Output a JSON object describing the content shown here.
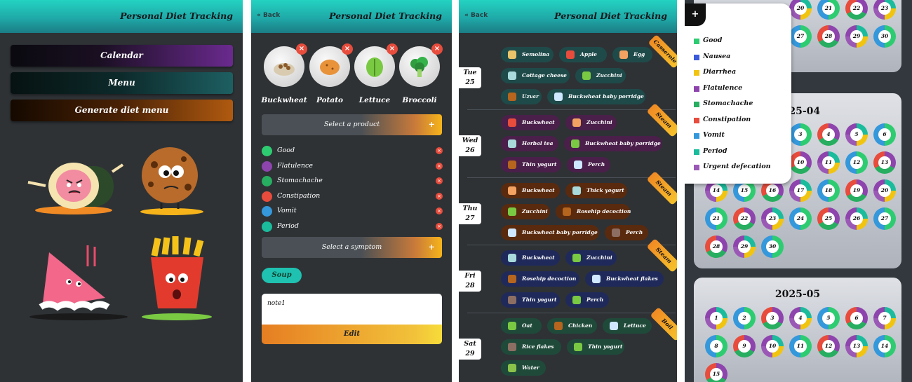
{
  "app_title": "Personal Diet Tracking",
  "back_label": "« Back",
  "home": {
    "buttons": [
      "Calendar",
      "Menu",
      "Generate diet menu"
    ]
  },
  "diary": {
    "products": [
      "Buckwheat",
      "Potato",
      "Lettuce",
      "Broccoli"
    ],
    "select_product": "Select a product",
    "symptoms": [
      {
        "label": "Good",
        "color": "#2ecc71"
      },
      {
        "label": "Flatulence",
        "color": "#8e44ad"
      },
      {
        "label": "Stomachache",
        "color": "#27ae60"
      },
      {
        "label": "Constipation",
        "color": "#e74c3c"
      },
      {
        "label": "Vomit",
        "color": "#3498db"
      },
      {
        "label": "Period",
        "color": "#1abc9c"
      }
    ],
    "select_symptom": "Select a symptom",
    "soup_tag": "Soup",
    "note_value": "note1",
    "edit_label": "Edit"
  },
  "menu": {
    "days": [
      {
        "dow": "Tue",
        "day": "25",
        "tag": "Casserole",
        "items": [
          "Semolina",
          "Apple",
          "Egg",
          "Cottage cheese",
          "Zucchini",
          "Uzvar",
          "Buckwheat baby porridge"
        ]
      },
      {
        "dow": "Wed",
        "day": "26",
        "tag": "Steam",
        "items": [
          "Buckwheat",
          "Zucchini",
          "Herbal tea",
          "Buckwheat baby porridge",
          "Thin yogurt",
          "Perch"
        ]
      },
      {
        "dow": "Thu",
        "day": "27",
        "tag": "Steam",
        "items": [
          "Buckwheat",
          "Thick yogurt",
          "Zucchini",
          "Rosehip decoction",
          "Buckwheat baby porridge",
          "Perch"
        ]
      },
      {
        "dow": "Fri",
        "day": "28",
        "tag": "Steam",
        "items": [
          "Buckwheat",
          "Zucchini",
          "Rosehip decoction",
          "Buckwheat flakes",
          "Thin yogurt",
          "Perch"
        ]
      },
      {
        "dow": "Sat",
        "day": "29",
        "tag": "Boil",
        "items": [
          "Oat",
          "Chicken",
          "Lettuce",
          "Rice flakes",
          "Thin yogurt",
          "Water"
        ]
      }
    ]
  },
  "calendar": {
    "months": [
      "2025-04",
      "2025-05"
    ],
    "top_days": [
      "20",
      "21",
      "22",
      "23",
      "27",
      "28",
      "29",
      "30"
    ],
    "april_days": 30,
    "may_days": 15,
    "legend_plus": "+",
    "legend": [
      {
        "label": "Good",
        "color": "#2ecc71"
      },
      {
        "label": "Nausea",
        "color": "#3b5bdb"
      },
      {
        "label": "Diarrhea",
        "color": "#f1c40f"
      },
      {
        "label": "Flatulence",
        "color": "#8e44ad"
      },
      {
        "label": "Stomachache",
        "color": "#27ae60"
      },
      {
        "label": "Constipation",
        "color": "#e74c3c"
      },
      {
        "label": "Vomit",
        "color": "#3498db"
      },
      {
        "label": "Period",
        "color": "#1abc9c"
      },
      {
        "label": "Urgent defecation",
        "color": "#9b59b6"
      }
    ]
  }
}
